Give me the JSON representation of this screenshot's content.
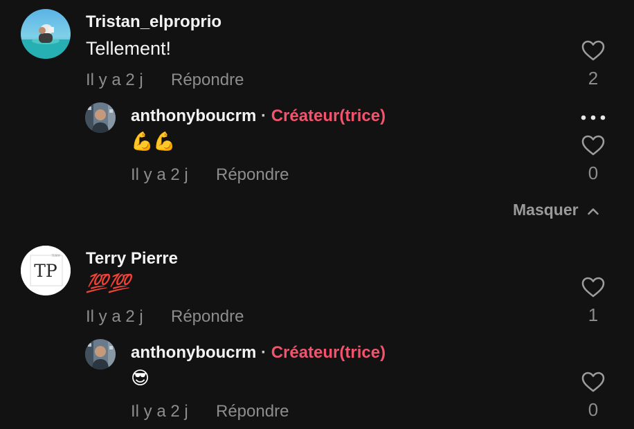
{
  "comments": [
    {
      "username": "Tristan_elproprio",
      "text": "Tellement!",
      "time": "Il y a 2 j",
      "reply_label": "Répondre",
      "likes": "2",
      "reply": {
        "username": "anthonyboucrm",
        "separator": "·",
        "creator_badge": "Créateur(trice)",
        "text": "💪💪",
        "time": "Il y a 2 j",
        "reply_label": "Répondre",
        "likes": "0"
      }
    },
    {
      "username": "Terry Pierre",
      "avatar_text": "TP",
      "avatar_small_text": "TERRY",
      "text": "💯💯",
      "time": "Il y a 2 j",
      "reply_label": "Répondre",
      "likes": "1",
      "reply": {
        "username": "anthonyboucrm",
        "separator": "·",
        "creator_badge": "Créateur(trice)",
        "text": "😎",
        "time": "Il y a 2 j",
        "reply_label": "Répondre",
        "likes": "0"
      }
    }
  ],
  "hide_replies_label": "Masquer",
  "icons": {
    "heart": "heart-outline-icon",
    "more": "more-horizontal-icon",
    "chevron": "chevron-up-icon"
  },
  "colors": {
    "background": "#121212",
    "creator_badge": "#f2546e",
    "secondary_text": "#8d8d8d"
  }
}
